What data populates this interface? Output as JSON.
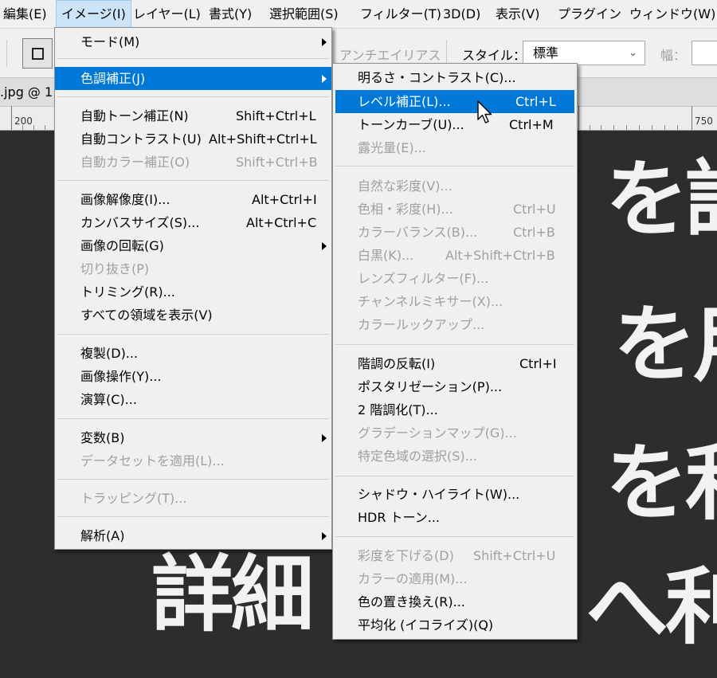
{
  "menubar": {
    "items": [
      {
        "label": "編集(E)"
      },
      {
        "label": "イメージ(I)"
      },
      {
        "label": "レイヤー(L)"
      },
      {
        "label": "書式(Y)"
      },
      {
        "label": "選択範囲(S)"
      },
      {
        "label": "フィルター(T)"
      },
      {
        "label": "3D(D)"
      },
      {
        "label": "表示(V)"
      },
      {
        "label": "プラグイン"
      },
      {
        "label": "ウィンドウ(W)"
      }
    ]
  },
  "options": {
    "antialias": "アンチエイリアス",
    "style_label": "スタイル：",
    "style_value": "標準",
    "width_label": "幅："
  },
  "document": {
    "tab_title": ".jpg @ 1",
    "ruler_labels": [
      "200",
      "750"
    ]
  },
  "canvas_text": [
    "を詳",
    "を用",
    "を利",
    "詳細",
    "へ利"
  ],
  "image_menu": {
    "items": [
      {
        "label": "モード(M)",
        "submenu": true
      },
      {
        "label": "色調補正(J)",
        "submenu": true,
        "highlighted": true
      },
      {
        "label": "自動トーン補正(N)",
        "shortcut": "Shift+Ctrl+L"
      },
      {
        "label": "自動コントラスト(U)",
        "shortcut": "Alt+Shift+Ctrl+L"
      },
      {
        "label": "自動カラー補正(O)",
        "shortcut": "Shift+Ctrl+B",
        "disabled": true
      },
      {
        "label": "画像解像度(I)...",
        "shortcut": "Alt+Ctrl+I"
      },
      {
        "label": "カンバスサイズ(S)...",
        "shortcut": "Alt+Ctrl+C"
      },
      {
        "label": "画像の回転(G)",
        "submenu": true
      },
      {
        "label": "切り抜き(P)",
        "disabled": true
      },
      {
        "label": "トリミング(R)..."
      },
      {
        "label": "すべての領域を表示(V)"
      },
      {
        "label": "複製(D)..."
      },
      {
        "label": "画像操作(Y)..."
      },
      {
        "label": "演算(C)..."
      },
      {
        "label": "変数(B)",
        "submenu": true
      },
      {
        "label": "データセットを適用(L)...",
        "disabled": true
      },
      {
        "label": "トラッピング(T)...",
        "disabled": true
      },
      {
        "label": "解析(A)",
        "submenu": true
      }
    ]
  },
  "adjust_menu": {
    "items": [
      {
        "label": "明るさ・コントラスト(C)..."
      },
      {
        "label": "レベル補正(L)...",
        "shortcut": "Ctrl+L",
        "highlighted": true
      },
      {
        "label": "トーンカーブ(U)...",
        "shortcut": "Ctrl+M"
      },
      {
        "label": "露光量(E)...",
        "disabled": true
      },
      {
        "label": "自然な彩度(V)...",
        "disabled": true
      },
      {
        "label": "色相・彩度(H)...",
        "shortcut": "Ctrl+U",
        "disabled": true
      },
      {
        "label": "カラーバランス(B)...",
        "shortcut": "Ctrl+B",
        "disabled": true
      },
      {
        "label": "白黒(K)...",
        "shortcut": "Alt+Shift+Ctrl+B",
        "disabled": true
      },
      {
        "label": "レンズフィルター(F)...",
        "disabled": true
      },
      {
        "label": "チャンネルミキサー(X)...",
        "disabled": true
      },
      {
        "label": "カラールックアップ...",
        "disabled": true
      },
      {
        "label": "階調の反転(I)",
        "shortcut": "Ctrl+I"
      },
      {
        "label": "ポスタリゼーション(P)..."
      },
      {
        "label": "2 階調化(T)..."
      },
      {
        "label": "グラデーションマップ(G)...",
        "disabled": true
      },
      {
        "label": "特定色域の選択(S)...",
        "disabled": true
      },
      {
        "label": "シャドウ・ハイライト(W)..."
      },
      {
        "label": "HDR トーン..."
      },
      {
        "label": "彩度を下げる(D)",
        "shortcut": "Shift+Ctrl+U",
        "disabled": true
      },
      {
        "label": "カラーの適用(M)...",
        "disabled": true
      },
      {
        "label": "色の置き換え(R)..."
      },
      {
        "label": "平均化 (イコライズ)(Q)"
      }
    ]
  },
  "colors": {
    "highlight": "#0078d7",
    "menu_bg": "#f0f0f0",
    "disabled_text": "#a0a0a0",
    "canvas_bg": "#2d2d2d"
  }
}
